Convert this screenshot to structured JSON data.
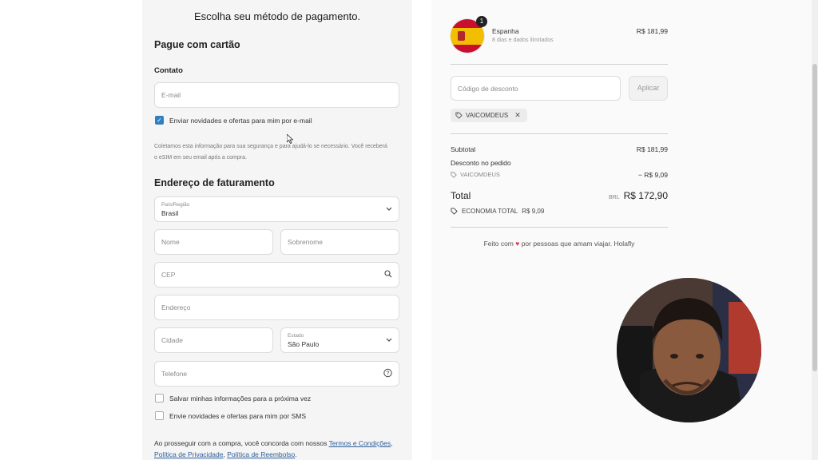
{
  "page_title": "Escolha seu método de pagamento.",
  "card_section": {
    "title": "Pague com cartão",
    "contact_label": "Contato",
    "email_placeholder": "E-mail",
    "newsletter_label": "Enviar novidades e ofertas para mim por e-mail",
    "privacy_note_line1": "Coletamos esta informação para sua segurança e para ajudá-lo se necessário. Você receberá",
    "privacy_note_line2": "o eSIM em seu email após a compra."
  },
  "billing": {
    "title": "Endereço de faturamento",
    "country_label": "País/Região",
    "country_value": "Brasil",
    "first_name_placeholder": "Nome",
    "last_name_placeholder": "Sobrenome",
    "cep_placeholder": "CEP",
    "address_placeholder": "Endereço",
    "city_placeholder": "Cidade",
    "state_label": "Estado",
    "state_value": "São Paulo",
    "phone_placeholder": "Telefone",
    "save_info_label": "Salvar minhas informações para a próxima vez",
    "sms_label": "Envie novidades e ofertas para mim por SMS"
  },
  "terms": {
    "prefix": "Ao prosseguir com a compra, você concorda com nossos",
    "terms_link": "Termos e Condições",
    "privacy_link": "Política de Privacidade",
    "refund_link": "Política de Reembolso"
  },
  "order": {
    "quantity_badge": "1",
    "product_name": "Espanha",
    "product_desc": "8 dias e dados ilimitados",
    "product_price": "R$ 181,99",
    "discount_placeholder": "Código de desconto",
    "apply_label": "Aplicar",
    "coupon_code": "VAICOMDEUS",
    "subtotal_label": "Subtotal",
    "subtotal_value": "R$ 181,99",
    "order_discount_label": "Desconto no pedido",
    "discount_code": "VAICOMDEUS",
    "discount_value": "− R$ 9,09",
    "total_label": "Total",
    "currency": "BRL",
    "total_value": "R$ 172,90",
    "savings_label": "ECONOMIA TOTAL",
    "savings_value": "R$ 9,09",
    "footer_prefix": "Feito com",
    "footer_suffix": "por pessoas que amam viajar. Holafly"
  },
  "colors": {
    "checkbox_accent": "#2f7fc1",
    "heart": "#e0344b",
    "flag_red": "#c8102e",
    "flag_yellow": "#f1bf00"
  },
  "icons": [
    "cursor-icon",
    "chevron-down-icon",
    "search-icon",
    "help-icon",
    "tag-icon",
    "close-icon",
    "heart-icon"
  ]
}
